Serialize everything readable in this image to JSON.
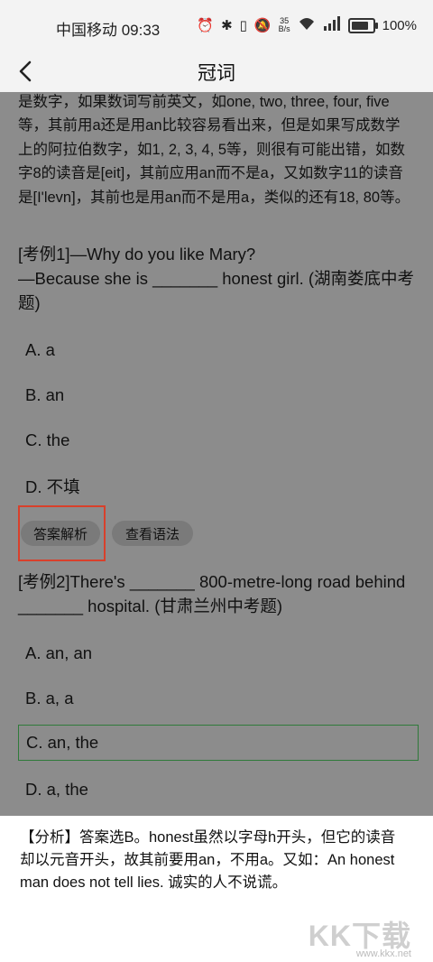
{
  "status": {
    "carrier_time": "中国移动 09:33",
    "speed_top": "35",
    "speed_unit": "B/s",
    "battery": "100%"
  },
  "header": {
    "title": "冠词"
  },
  "lesson": {
    "paragraph": "是数字，如果数词写前英文，如one, two, three, four, five等，其前用a还是用an比较容易看出来，但是如果写成数学上的阿拉伯数字，如1, 2, 3, 4, 5等，则很有可能出错，如数字8的读音是[eit]，其前应用an而不是a，又如数字11的读音是[I'levn]，其前也是用an而不是用a，类似的还有18, 80等。",
    "example1": {
      "line1": "[考例1]—Why do you like Mary?",
      "line2": "—Because she is _______ honest girl. (湖南娄底中考题)",
      "options": [
        "A. a",
        "B. an",
        "C. the",
        "D. 不填"
      ]
    },
    "buttons": {
      "answer": "答案解析",
      "grammar": "查看语法"
    },
    "example2": {
      "text": "[考例2]There's _______ 800-metre-long road behind _______ hospital. (甘肃兰州中考题)",
      "options": [
        "A. an, an",
        "B. a, a",
        "C. an, the",
        "D. a, the"
      ]
    }
  },
  "analysis": {
    "text": "【分析】答案选B。honest虽然以字母h开头，但它的读音却以元音开头，故其前要用an，不用a。又如：An honest man does not tell lies. 诚实的人不说谎。"
  },
  "watermark": {
    "logo": "KK下载",
    "url": "www.kkx.net"
  }
}
